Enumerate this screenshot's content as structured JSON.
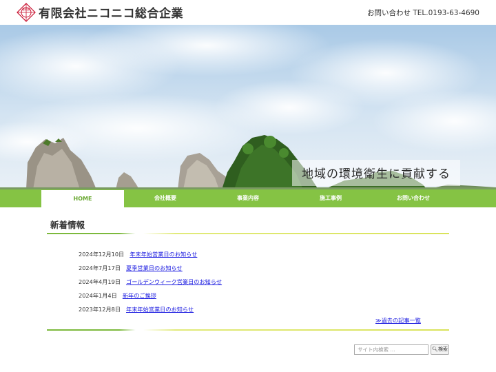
{
  "header": {
    "company_name": "有限会社ニコニコ総合企業",
    "logo_icon": "nikoniko-logo-icon",
    "contact": "お問い合わせ TEL.0193-63-4690"
  },
  "hero": {
    "tagline": "地域の環境衛生に貢献する"
  },
  "nav": {
    "items": [
      {
        "label": "HOME",
        "active": true
      },
      {
        "label": "会社概要",
        "active": false
      },
      {
        "label": "事業内容",
        "active": false
      },
      {
        "label": "施工事例",
        "active": false
      },
      {
        "label": "お問い合わせ",
        "active": false
      }
    ]
  },
  "news": {
    "title": "新着情報",
    "items": [
      {
        "date": "2024年12月10日",
        "title": "年末年始営業日のお知らせ"
      },
      {
        "date": "2024年7月17日",
        "title": "夏季営業日のお知らせ"
      },
      {
        "date": "2024年4月19日",
        "title": "ゴールデンウィーク営業日のお知らせ"
      },
      {
        "date": "2024年1月4日",
        "title": "新年のご挨拶"
      },
      {
        "date": "2023年12月8日",
        "title": "年末年始営業日のお知らせ"
      }
    ],
    "archive_link": "≫過去の記事一覧"
  },
  "search": {
    "placeholder": "サイト内検索 ...",
    "button_label": "検索",
    "button_icon": "search-icon"
  },
  "colors": {
    "nav_green": "#85c344",
    "link_blue": "#1a1ae0",
    "logo_red": "#c8102e"
  }
}
